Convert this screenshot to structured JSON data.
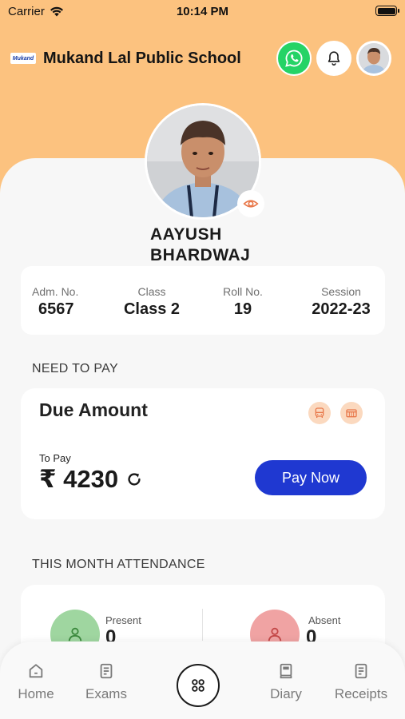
{
  "status_bar": {
    "carrier": "Carrier",
    "time": "10:14 PM"
  },
  "header": {
    "logo_text": "Mukand",
    "school_name": "Mukand Lal Public School",
    "icons": [
      "whatsapp-icon",
      "bell-icon",
      "avatar"
    ]
  },
  "student": {
    "name": "AAYUSH BHARDWAJ",
    "info": [
      {
        "label": "Adm. No.",
        "value": "6567"
      },
      {
        "label": "Class",
        "value": "Class 2"
      },
      {
        "label": "Roll No.",
        "value": "19"
      },
      {
        "label": "Session",
        "value": "2022-23"
      }
    ]
  },
  "payment": {
    "section_title": "NEED TO PAY",
    "card_title": "Due Amount",
    "to_pay_label": "To Pay",
    "amount": "₹ 4230",
    "pay_button": "Pay Now",
    "icons": [
      "bus-icon",
      "fee-icon",
      "refresh-icon"
    ]
  },
  "attendance": {
    "section_title": "THIS MONTH ATTENDANCE",
    "present_label": "Present",
    "present_value": "0",
    "absent_label": "Absent",
    "absent_value": "0"
  },
  "nav": {
    "home": "Home",
    "exams": "Exams",
    "diary": "Diary",
    "receipts": "Receipts"
  },
  "colors": {
    "header_bg": "#fcc27f",
    "accent_blue": "#1f38d1",
    "whatsapp_green": "#25d366",
    "present_green": "#9fd6a0",
    "absent_red": "#f0a3a3"
  }
}
